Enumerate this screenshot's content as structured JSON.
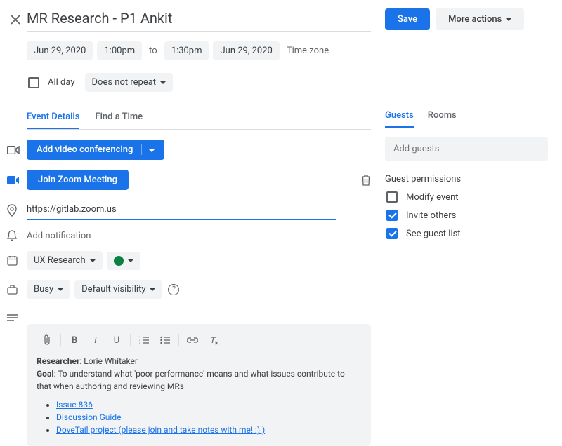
{
  "header": {
    "title": "MR Research - P1 Ankit",
    "save": "Save",
    "more_actions": "More actions"
  },
  "datetime": {
    "start_date": "Jun 29, 2020",
    "start_time": "1:00pm",
    "to": "to",
    "end_time": "1:30pm",
    "end_date": "Jun 29, 2020",
    "timezone": "Time zone"
  },
  "allday": {
    "label": "All day",
    "repeat": "Does not repeat"
  },
  "tabs": {
    "details": "Event Details",
    "find_time": "Find a Time"
  },
  "video": {
    "add": "Add video conferencing",
    "join": "Join Zoom Meeting",
    "url": "https://gitlab.zoom.us"
  },
  "notification": "Add notification",
  "calendar": "UX Research",
  "availability": "Busy",
  "visibility": "Default visibility",
  "description": {
    "researcher_label": "Researcher",
    "researcher": "Lorie Whitaker",
    "goal_label": "Goal",
    "goal": "To understand what 'poor performance' means and what issues contribute to that when authoring and reviewing MRs",
    "links": [
      "Issue 836",
      "Discussion Guide",
      "DoveTail project (please join and take notes with me! :) )"
    ]
  },
  "guests": {
    "tab_guests": "Guests",
    "tab_rooms": "Rooms",
    "placeholder": "Add guests",
    "perm_title": "Guest permissions",
    "modify": "Modify event",
    "invite": "Invite others",
    "see_list": "See guest list"
  }
}
